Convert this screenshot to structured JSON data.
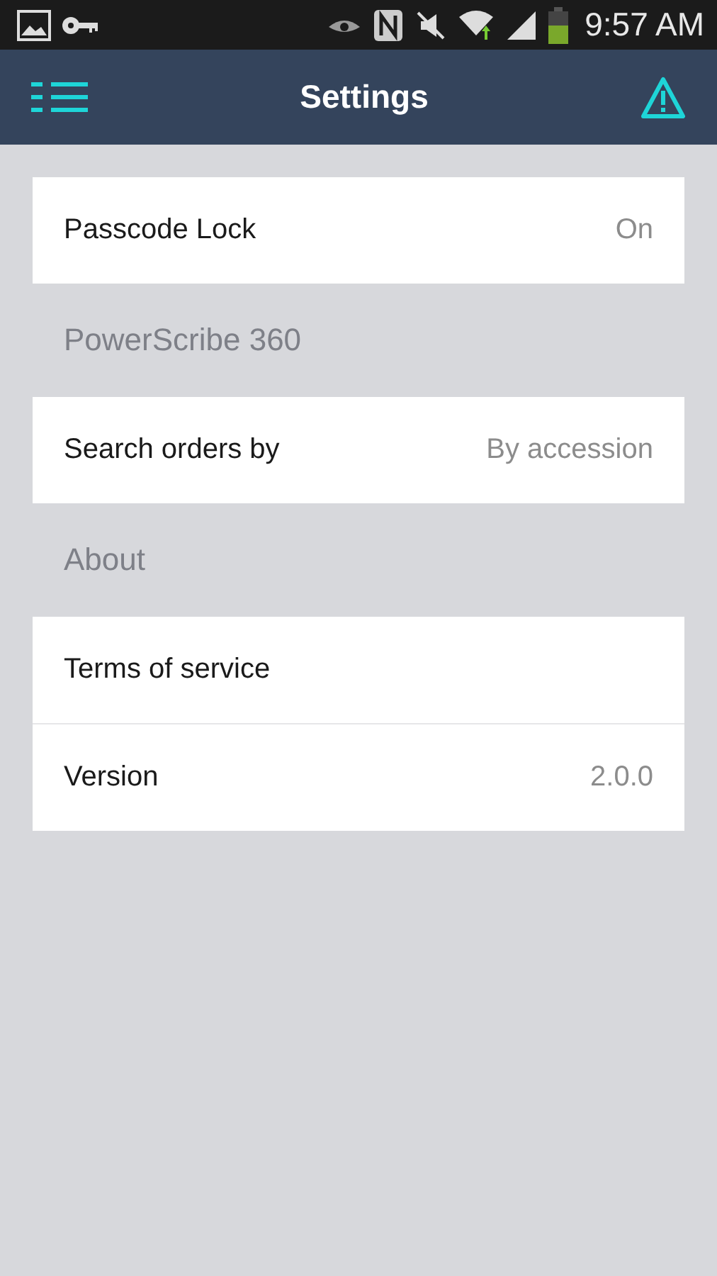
{
  "status_bar": {
    "time": "9:57 AM"
  },
  "app_bar": {
    "title": "Settings"
  },
  "sections": [
    {
      "rows": [
        {
          "label": "Passcode Lock",
          "value": "On"
        }
      ]
    },
    {
      "header": "PowerScribe 360",
      "rows": [
        {
          "label": "Search orders by",
          "value": "By accession"
        }
      ]
    },
    {
      "header": "About",
      "rows": [
        {
          "label": "Terms of service"
        },
        {
          "label": "Version",
          "value": "2.0.0"
        }
      ]
    }
  ]
}
